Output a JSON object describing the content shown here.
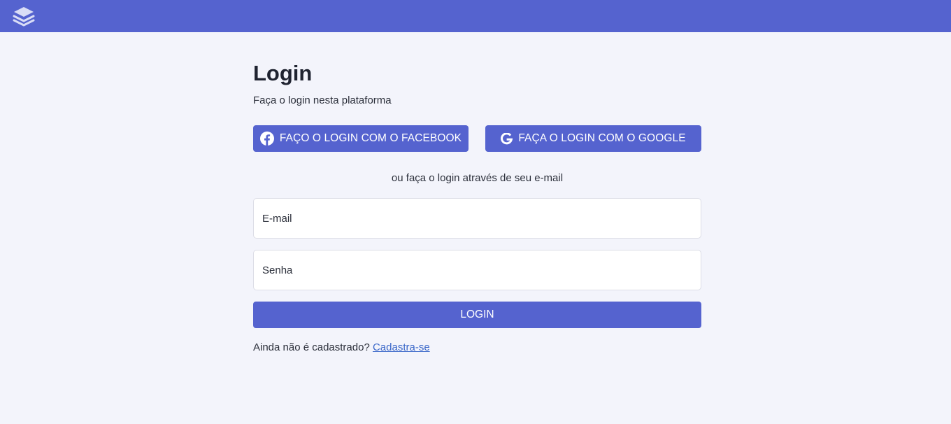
{
  "header": {
    "logo_icon": "stacked-layers-icon"
  },
  "login": {
    "title": "Login",
    "subtitle": "Faça o login nesta plataforma",
    "facebook_button": {
      "label": "FAÇO O LOGIN COM O FACEBOOK",
      "icon": "facebook-icon"
    },
    "google_button": {
      "label": "FAÇA O LOGIN COM O GOOGLE",
      "icon": "google-icon"
    },
    "divider_text": "ou faça o login através de seu e-mail",
    "email_placeholder": "E-mail",
    "password_placeholder": "Senha",
    "submit_label": "LOGIN",
    "signup_prompt": "Ainda não é cadastrado?",
    "signup_link": "Cadastra-se"
  },
  "colors": {
    "brand": "#5563cf",
    "background": "#f3f4fb",
    "link": "#3a67c9"
  }
}
